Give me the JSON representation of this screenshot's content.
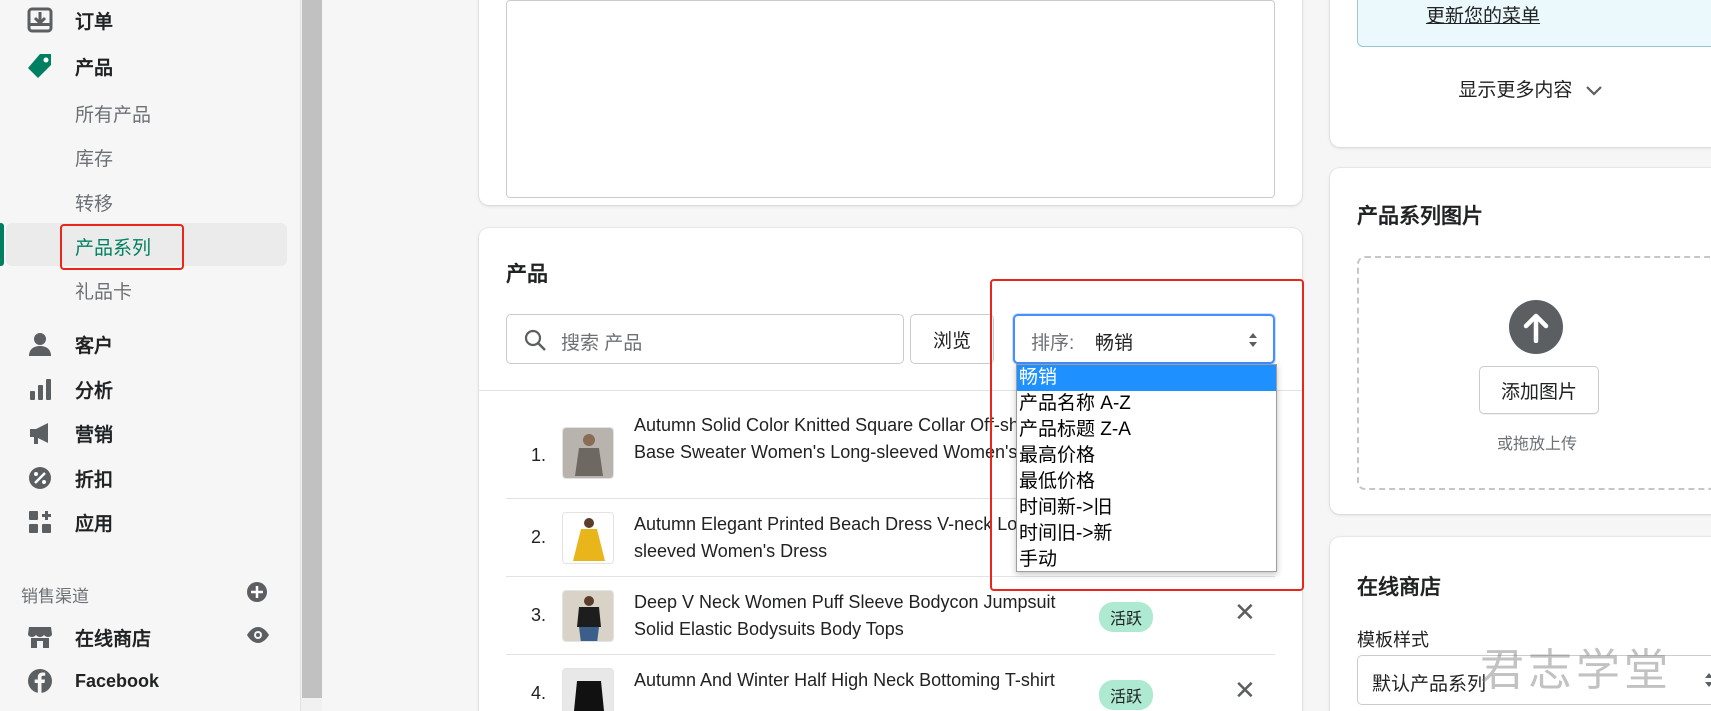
{
  "sidebar": {
    "items": [
      {
        "label": "订单",
        "icon": "orders-icon"
      },
      {
        "label": "产品",
        "icon": "tag-icon"
      },
      {
        "label": "客户",
        "icon": "person-icon"
      },
      {
        "label": "分析",
        "icon": "bar-chart-icon"
      },
      {
        "label": "营销",
        "icon": "megaphone-icon"
      },
      {
        "label": "折扣",
        "icon": "discount-icon"
      },
      {
        "label": "应用",
        "icon": "apps-icon"
      }
    ],
    "product_sub": [
      "所有产品",
      "库存",
      "转移",
      "产品系列",
      "礼品卡"
    ],
    "sales_channels_label": "销售渠道",
    "channels": [
      {
        "label": "在线商店",
        "icon": "store-icon"
      },
      {
        "label": "Facebook",
        "icon": "facebook-icon"
      }
    ]
  },
  "products_card": {
    "title": "产品",
    "search_placeholder": "搜索 产品",
    "browse_label": "浏览",
    "sort_prefix": "排序:",
    "sort_value": "畅销",
    "sort_options": [
      "畅销",
      "产品名称 A-Z",
      "产品标题 Z-A",
      "最高价格",
      "最低价格",
      "时间新->旧",
      "时间旧->新",
      "手动"
    ],
    "rows": [
      {
        "num": "1.",
        "title": "Autumn Solid Color Knitted Square Collar Off-shoulder Base Sweater Women's Long-sleeved Women's Clothing",
        "status": ""
      },
      {
        "num": "2.",
        "title": "Autumn Elegant Printed Beach Dress V-neck Long-sleeved Women's Dress",
        "status": ""
      },
      {
        "num": "3.",
        "title": "Deep V Neck Women Puff Sleeve Bodycon Jumpsuit Solid Elastic Bodysuits Body Tops",
        "status": "活跃"
      },
      {
        "num": "4.",
        "title": "Autumn And Winter Half High Neck Bottoming T-shirt",
        "status": "活跃"
      }
    ]
  },
  "right": {
    "menu_link": "更新您的菜单",
    "show_more": "显示更多内容",
    "image_card_title": "产品系列图片",
    "add_image": "添加图片",
    "drag_hint": "或拖放上传",
    "online_store_title": "在线商店",
    "template_label": "模板样式",
    "template_value": "默认产品系列"
  },
  "watermark": "君志学堂",
  "colors": {
    "accent": "#008060",
    "highlight_box": "#e8271a",
    "badge": "#aee9d1",
    "selected_option": "#1e90ff"
  }
}
